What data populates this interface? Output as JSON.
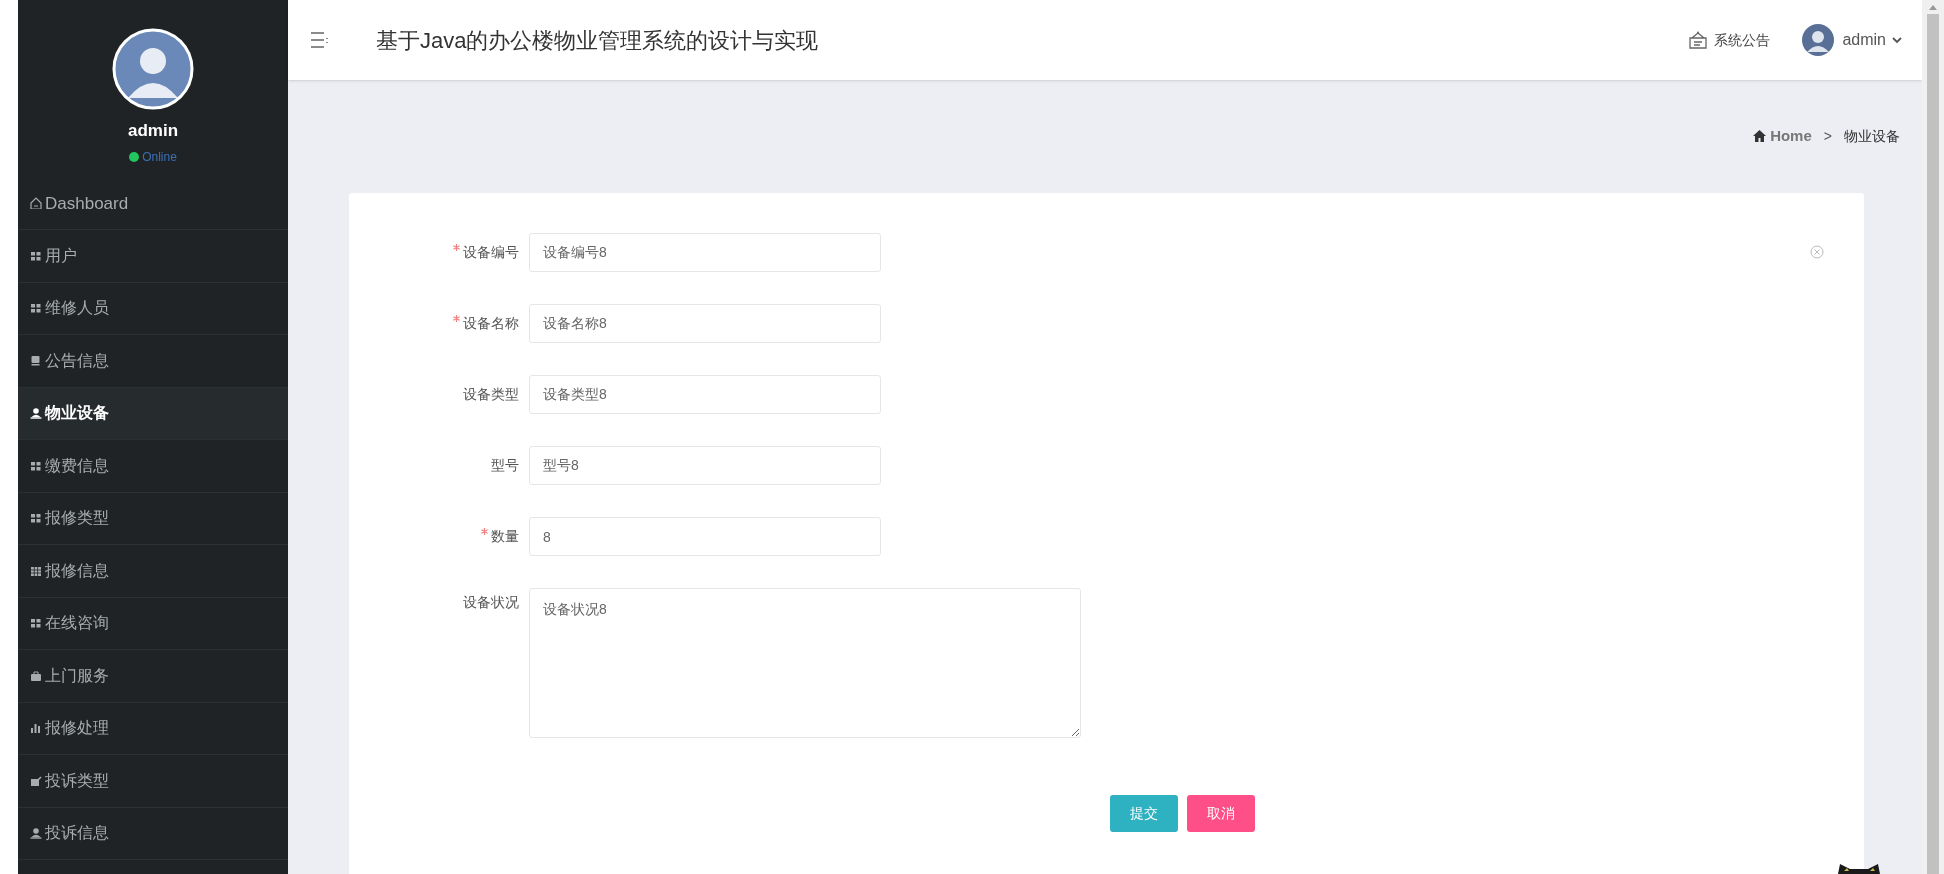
{
  "header": {
    "title": "基于Java的办公楼物业管理系统的设计与实现",
    "notice": "系统公告",
    "user": "admin"
  },
  "sidebar": {
    "user": "admin",
    "status": "Online",
    "items": [
      {
        "label": "Dashboard",
        "kind": "home",
        "selected": false
      },
      {
        "label": "用户",
        "kind": "grid",
        "selected": false
      },
      {
        "label": "维修人员",
        "kind": "grid",
        "selected": false
      },
      {
        "label": "公告信息",
        "kind": "bookmark",
        "selected": false
      },
      {
        "label": "物业设备",
        "kind": "user",
        "selected": true
      },
      {
        "label": "缴费信息",
        "kind": "grid",
        "selected": false
      },
      {
        "label": "报修类型",
        "kind": "grid",
        "selected": false
      },
      {
        "label": "报修信息",
        "kind": "table",
        "selected": false
      },
      {
        "label": "在线咨询",
        "kind": "grid",
        "selected": false
      },
      {
        "label": "上门服务",
        "kind": "briefcase",
        "selected": false
      },
      {
        "label": "报修处理",
        "kind": "bars",
        "selected": false
      },
      {
        "label": "投诉类型",
        "kind": "edit",
        "selected": false
      },
      {
        "label": "投诉信息",
        "kind": "user",
        "selected": false
      }
    ]
  },
  "breadcrumb": {
    "home": "Home",
    "separator": ">",
    "current": "物业设备"
  },
  "form": {
    "fields": [
      {
        "label": "设备编号",
        "required": true,
        "kind": "input",
        "value": "设备编号8"
      },
      {
        "label": "设备名称",
        "required": true,
        "kind": "input",
        "value": "设备名称8"
      },
      {
        "label": "设备类型",
        "required": false,
        "kind": "input",
        "value": "设备类型8"
      },
      {
        "label": "型号",
        "required": false,
        "kind": "input",
        "value": "型号8"
      },
      {
        "label": "数量",
        "required": true,
        "kind": "input",
        "value": "8"
      },
      {
        "label": "设备状况",
        "required": false,
        "kind": "textarea",
        "value": "设备状况8"
      }
    ],
    "buttons": [
      {
        "label": "提交",
        "kind": "primary"
      },
      {
        "label": "取消",
        "kind": "danger"
      }
    ]
  }
}
